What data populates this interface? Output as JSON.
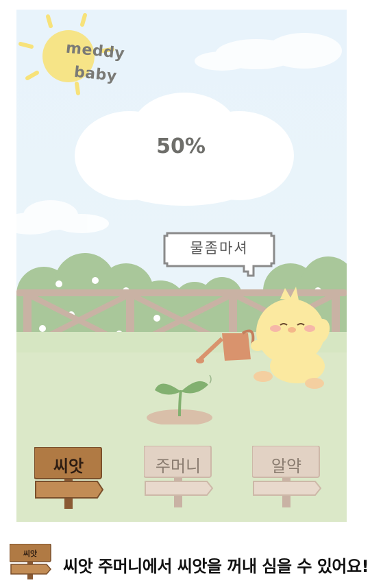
{
  "logo": {
    "line1": "meddy",
    "line2": "baby"
  },
  "progress": {
    "percent_text": "50%",
    "value": 50
  },
  "chick": {
    "speech": "물좀마셔"
  },
  "signs": [
    {
      "id": "seed",
      "label": "씨앗",
      "active": true
    },
    {
      "id": "pouch",
      "label": "주머니",
      "active": false
    },
    {
      "id": "medicine",
      "label": "알약",
      "active": false
    }
  ],
  "hint": {
    "icon_label": "씨앗",
    "text": "씨앗 주머니에서 씨앗을 꺼내 심을 수 있어요!"
  },
  "colors": {
    "sky": "#e8f3fb",
    "grass": "#dbe8c8",
    "fence": "#c9b2a4",
    "bush": "#a9c79a",
    "chick": "#fbe9a0",
    "sun": "#f7e27a",
    "sign_active": "#b07a44",
    "sign_inactive": "#e2d2c4"
  }
}
